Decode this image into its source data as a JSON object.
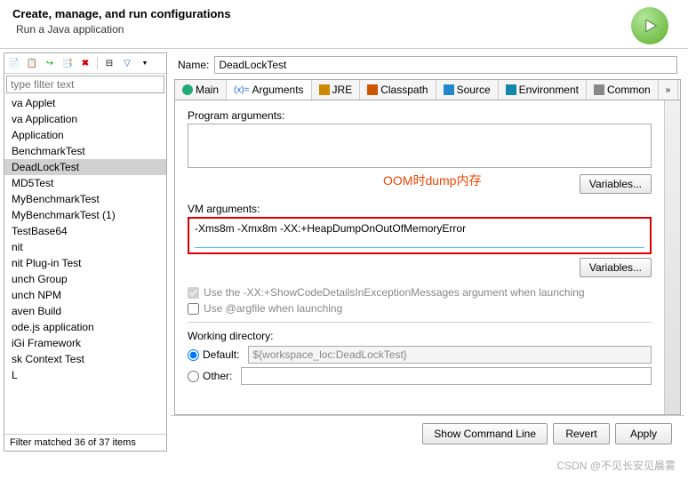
{
  "header": {
    "title": "Create, manage, and run configurations",
    "subtitle": "Run a Java application"
  },
  "filter": {
    "placeholder": "type filter text"
  },
  "tree": {
    "items": [
      "va Applet",
      "va Application",
      "Application",
      "BenchmarkTest",
      "DeadLockTest",
      "MD5Test",
      "MyBenchmarkTest",
      "MyBenchmarkTest (1)",
      "TestBase64",
      "nit",
      "nit Plug-in Test",
      "unch Group",
      "unch NPM",
      "aven Build",
      "ode.js application",
      "iGi Framework",
      "sk Context Test",
      "L"
    ],
    "selected": "DeadLockTest",
    "status": "Filter matched 36 of 37 items"
  },
  "name": {
    "label": "Name:",
    "value": "DeadLockTest"
  },
  "tabs": [
    "Main",
    "Arguments",
    "JRE",
    "Classpath",
    "Source",
    "Environment",
    "Common"
  ],
  "activeTab": "Arguments",
  "sections": {
    "progArgsLabel": "Program arguments:",
    "variablesBtn": "Variables...",
    "vmArgsLabel": "VM arguments:",
    "vmArgsValue": "-Xms8m -Xmx8m -XX:+HeapDumpOnOutOfMemoryError",
    "annotation": "OOM时dump内存",
    "useShowCode": "Use the -XX:+ShowCodeDetailsInExceptionMessages argument when launching",
    "useArgfile": "Use @argfile when launching",
    "wdLabel": "Working directory:",
    "wdDefault": "Default:",
    "wdDefaultValue": "${workspace_loc:DeadLockTest}",
    "wdOther": "Other:"
  },
  "buttons": {
    "showCmd": "Show Command Line",
    "revert": "Revert",
    "apply": "Apply"
  },
  "watermark": "CSDN @不见长安见晨雾"
}
